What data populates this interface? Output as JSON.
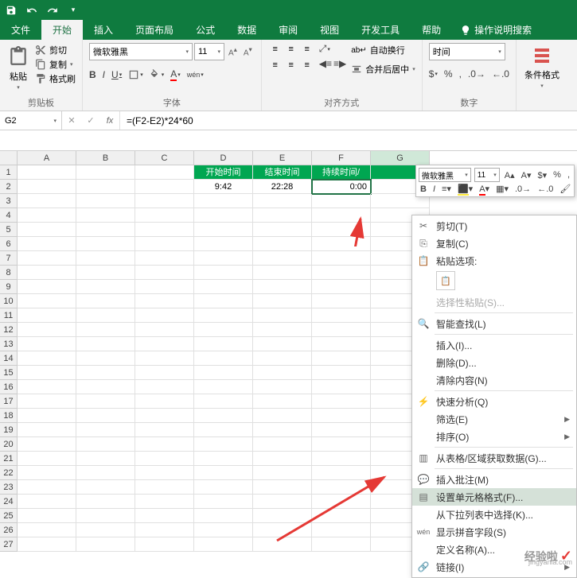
{
  "tabs": {
    "file": "文件",
    "home": "开始",
    "insert": "插入",
    "page_layout": "页面布局",
    "formulas": "公式",
    "data": "数据",
    "review": "审阅",
    "view": "视图",
    "developer": "开发工具",
    "help": "帮助",
    "tell_me": "操作说明搜索"
  },
  "ribbon": {
    "clipboard": {
      "paste": "粘贴",
      "cut": "剪切",
      "copy": "复制",
      "format_painter": "格式刷",
      "label": "剪贴板"
    },
    "font": {
      "name": "微软雅黑",
      "size": "11",
      "bold": "B",
      "italic": "I",
      "underline": "U",
      "ruby": "wén",
      "label": "字体"
    },
    "alignment": {
      "wrap": "自动换行",
      "merge": "合并后居中",
      "label": "对齐方式"
    },
    "number": {
      "format": "时间",
      "percent": "%",
      "label": "数字"
    },
    "styles": {
      "conditional": "条件格式",
      "label": ""
    }
  },
  "namebox": "G2",
  "formula": "=(F2-E2)*24*60",
  "columns": [
    "A",
    "B",
    "C",
    "D",
    "E",
    "F",
    "G"
  ],
  "header_row": {
    "D": "开始时间",
    "E": "结束时间",
    "F": "持续时间/"
  },
  "data_row": {
    "D": "9:42",
    "E": "22:28",
    "F": "0:00"
  },
  "mini_toolbar": {
    "font": "微软雅黑",
    "size": "11",
    "bold": "B",
    "italic": "I"
  },
  "context_menu": {
    "cut": "剪切(T)",
    "copy": "复制(C)",
    "paste_options": "粘贴选项:",
    "paste_special": "选择性粘贴(S)...",
    "smart_lookup": "智能查找(L)",
    "insert": "插入(I)...",
    "delete": "删除(D)...",
    "clear": "清除内容(N)",
    "quick_analysis": "快速分析(Q)",
    "filter": "筛选(E)",
    "sort": "排序(O)",
    "get_data": "从表格/区域获取数据(G)...",
    "insert_comment": "插入批注(M)",
    "format_cells": "设置单元格格式(F)...",
    "pick_from_list": "从下拉列表中选择(K)...",
    "show_phonetic": "显示拼音字段(S)",
    "define_name": "定义名称(A)...",
    "hyperlink": "链接(I)"
  },
  "watermark": {
    "brand": "经验啦",
    "url": "jingyanla.com"
  }
}
